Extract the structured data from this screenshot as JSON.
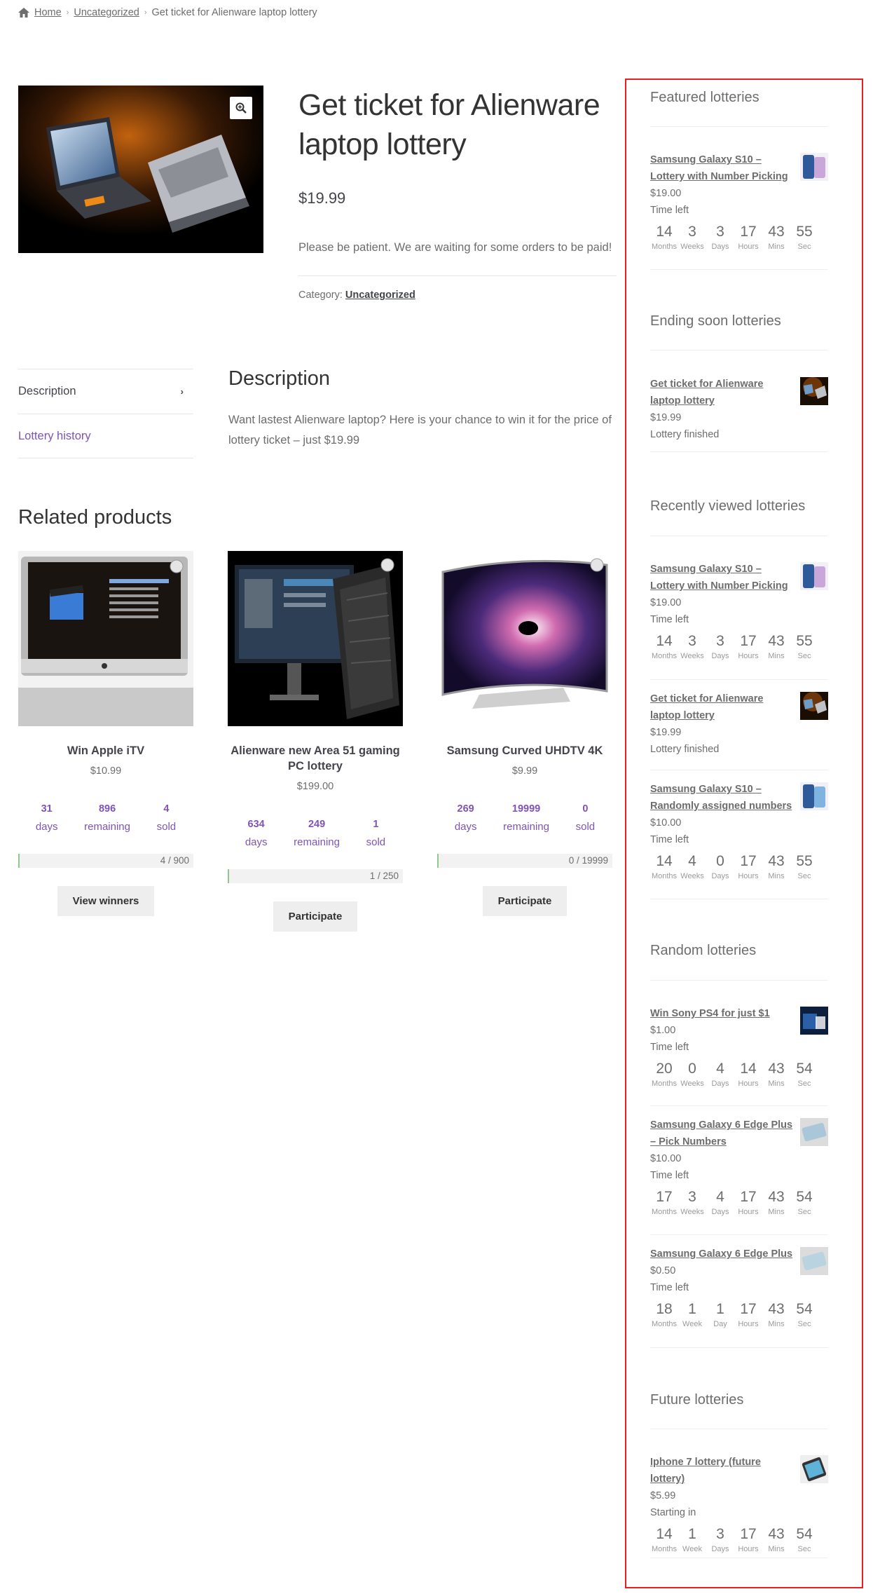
{
  "breadcrumb": {
    "home": "Home",
    "category": "Uncategorized",
    "current": "Get ticket for Alienware laptop lottery"
  },
  "product": {
    "title": "Get ticket for Alienware laptop lottery",
    "price": "$19.99",
    "notice": "Please be patient. We are waiting for some orders to be paid!",
    "category_label": "Category:",
    "category": "Uncategorized"
  },
  "tabs": {
    "description": "Description",
    "history": "Lottery history"
  },
  "description": {
    "heading": "Description",
    "text": "Want lastest Alienware laptop? Here is your chance to win it for the price of lottery ticket – just $19.99"
  },
  "related": {
    "heading": "Related products",
    "products": [
      {
        "title": "Win Apple iTV",
        "price": "$10.99",
        "days": "31",
        "days_label": "days",
        "remaining": "896",
        "remaining_label": "remaining",
        "sold": "4",
        "sold_label": "sold",
        "progress": "4 / 900",
        "progress_fraction": 0.0044,
        "button": "View winners"
      },
      {
        "title": "Alienware new Area 51 gaming PC lottery",
        "price": "$199.00",
        "days": "634",
        "days_label": "days",
        "remaining": "249",
        "remaining_label": "remaining",
        "sold": "1",
        "sold_label": "sold",
        "progress": "1 / 250",
        "progress_fraction": 0.004,
        "button": "Participate"
      },
      {
        "title": "Samsung Curved UHDTV 4K",
        "price": "$9.99",
        "days": "269",
        "days_label": "days",
        "remaining": "19999",
        "remaining_label": "remaining",
        "sold": "0",
        "sold_label": "sold",
        "progress": "0 / 19999",
        "progress_fraction": 0.0,
        "button": "Participate"
      }
    ]
  },
  "sidebar": {
    "featured": {
      "title": "Featured lotteries",
      "items": [
        {
          "name": "Samsung Galaxy S10 – Lottery with Number Picking",
          "price": "$19.00",
          "status": "Time left",
          "countdown": [
            "14",
            "3",
            "3",
            "17",
            "43",
            "55"
          ],
          "labels": [
            "Months",
            "Weeks",
            "Days",
            "Hours",
            "Mins",
            "Sec"
          ],
          "icon": "phone-thumb"
        }
      ]
    },
    "ending": {
      "title": "Ending soon lotteries",
      "items": [
        {
          "name": "Get ticket for Alienware laptop lottery",
          "price": "$19.99",
          "status": "Lottery finished",
          "icon": "laptop-thumb"
        }
      ]
    },
    "recent": {
      "title": "Recently viewed lotteries",
      "items": [
        {
          "name": "Samsung Galaxy S10 – Lottery with Number Picking",
          "price": "$19.00",
          "status": "Time left",
          "countdown": [
            "14",
            "3",
            "3",
            "17",
            "43",
            "55"
          ],
          "labels": [
            "Months",
            "Weeks",
            "Days",
            "Hours",
            "Mins",
            "Sec"
          ],
          "icon": "phone-thumb"
        },
        {
          "name": "Get ticket for Alienware laptop lottery",
          "price": "$19.99",
          "status": "Lottery finished",
          "icon": "laptop-thumb"
        },
        {
          "name": "Samsung Galaxy S10 – Randomly assigned numbers",
          "price": "$10.00",
          "status": "Time left",
          "countdown": [
            "14",
            "4",
            "0",
            "17",
            "43",
            "55"
          ],
          "labels": [
            "Months",
            "Weeks",
            "Days",
            "Hours",
            "Mins",
            "Sec"
          ],
          "icon": "phone-thumb"
        }
      ]
    },
    "random": {
      "title": "Random lotteries",
      "items": [
        {
          "name": "Win Sony PS4 for just $1",
          "price": "$1.00",
          "status": "Time left",
          "countdown": [
            "20",
            "0",
            "4",
            "14",
            "43",
            "54"
          ],
          "labels": [
            "Months",
            "Weeks",
            "Days",
            "Hours",
            "Mins",
            "Sec"
          ],
          "icon": "ps4-thumb"
        },
        {
          "name": "Samsung Galaxy 6 Edge Plus – Pick Numbers",
          "price": "$10.00",
          "status": "Time left",
          "countdown": [
            "17",
            "3",
            "4",
            "17",
            "43",
            "54"
          ],
          "labels": [
            "Months",
            "Weeks",
            "Days",
            "Hours",
            "Mins",
            "Sec"
          ],
          "icon": "galaxy-thumb"
        },
        {
          "name": "Samsung Galaxy 6 Edge Plus",
          "price": "$0.50",
          "status": "Time left",
          "countdown": [
            "18",
            "1",
            "1",
            "17",
            "43",
            "54"
          ],
          "labels": [
            "Months",
            "Week",
            "Day",
            "Hours",
            "Mins",
            "Sec"
          ],
          "icon": "galaxy-thumb"
        }
      ]
    },
    "future": {
      "title": "Future lotteries",
      "items": [
        {
          "name": "Iphone 7 lottery (future lottery)",
          "price": "$5.99",
          "status": "Starting in",
          "countdown": [
            "14",
            "1",
            "3",
            "17",
            "43",
            "54"
          ],
          "labels": [
            "Months",
            "Week",
            "Days",
            "Hours",
            "Mins",
            "Sec"
          ],
          "icon": "iphone-thumb"
        }
      ]
    }
  }
}
